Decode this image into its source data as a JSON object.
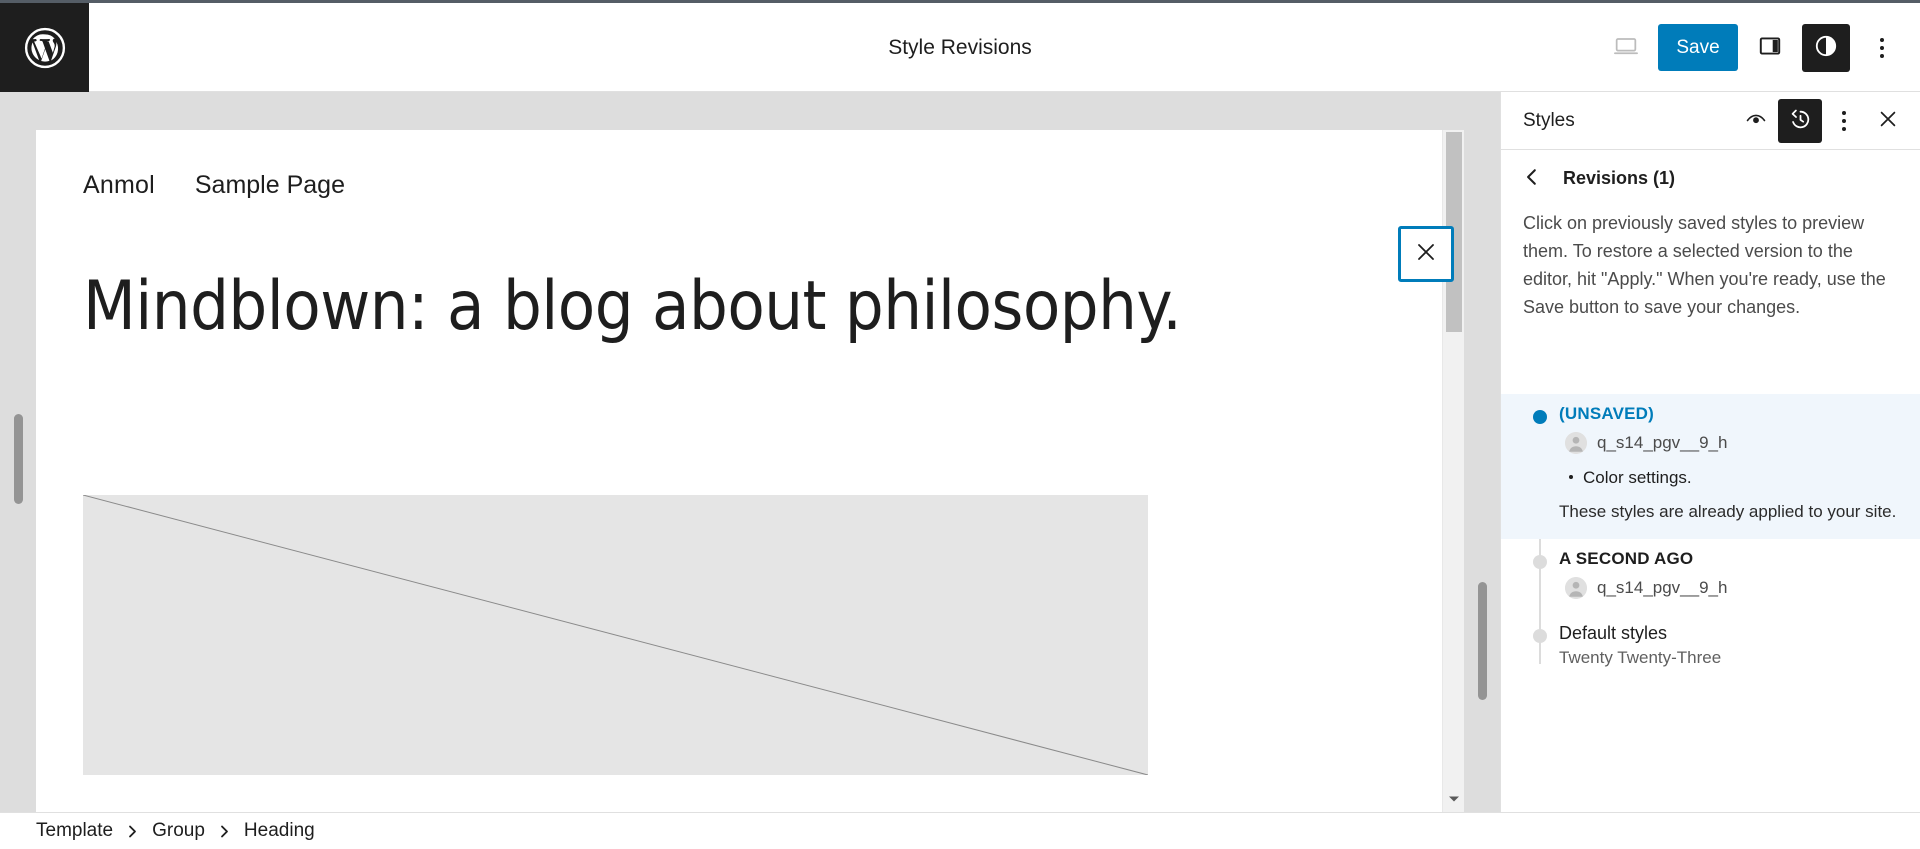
{
  "header": {
    "logo_icon": "wordpress-logo-icon",
    "title": "Style Revisions",
    "device_preview_icon": "laptop-icon",
    "save_label": "Save",
    "sidebar_toggle_icon": "sidebar-panel-icon",
    "styles_icon": "styles-contrast-icon",
    "options_icon": "vertical-dots-icon"
  },
  "canvas": {
    "site_title": "Anmol",
    "nav_link": "Sample Page",
    "post_heading": "Mindblown: a blog about philosophy.",
    "close_icon": "close-icon",
    "scroll_down_icon": "chevron-down-icon"
  },
  "sidebar": {
    "title": "Styles",
    "preview_icon": "eye-icon",
    "revisions_icon": "revision-history-icon",
    "more_icon": "vertical-dots-icon",
    "close_icon": "close-icon",
    "back_icon": "chevron-left-icon",
    "revisions_title": "Revisions (1)",
    "description": "Click on previously saved styles to preview them. To restore a selected version to the editor, hit \"Apply.\" When you're ready, use the Save button to save your changes.",
    "revisions": [
      {
        "label": "(UNSAVED)",
        "author": "q_s14_pgv__9_h",
        "changes": [
          "Color settings."
        ],
        "note": "These styles are already applied to your site.",
        "selected": true
      },
      {
        "label": "A SECOND AGO",
        "author": "q_s14_pgv__9_h",
        "selected": false
      },
      {
        "label": "Default styles",
        "sub": "Twenty Twenty-Three",
        "selected": false
      }
    ]
  },
  "breadcrumb": {
    "items": [
      "Template",
      "Group",
      "Heading"
    ],
    "separator": "›"
  },
  "colors": {
    "accent": "#007cba",
    "dark": "#1e1e1e",
    "canvas_bg": "#dddddd",
    "selected_bg": "#f0f6fc"
  }
}
